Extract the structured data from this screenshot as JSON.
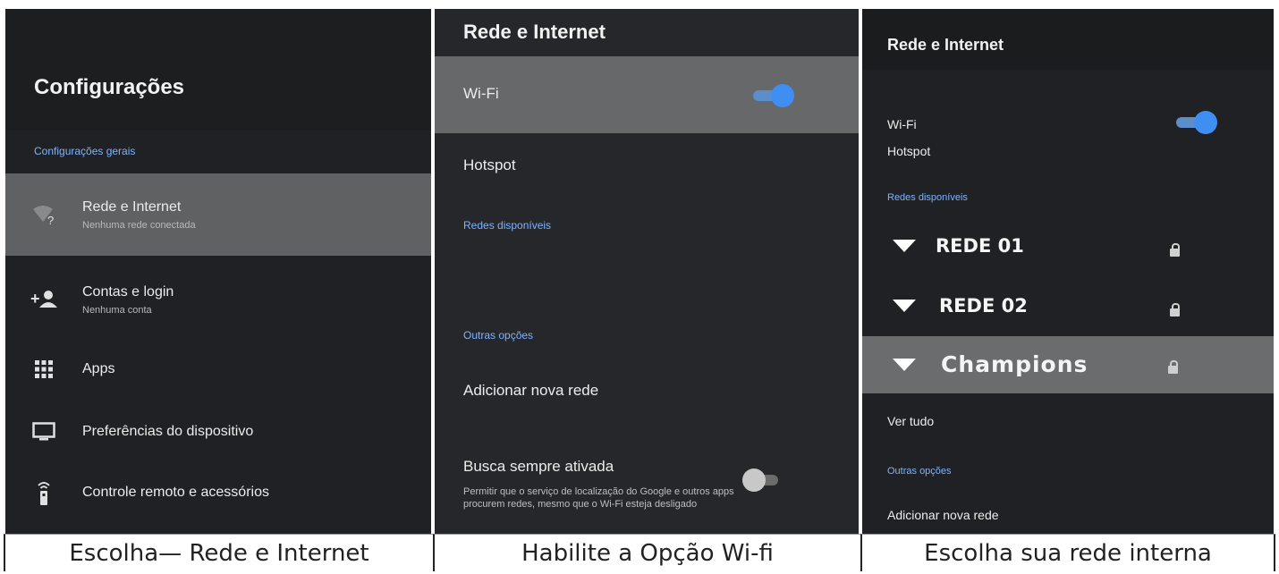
{
  "panel1": {
    "title": "Configurações",
    "section": "Configurações gerais",
    "items": [
      {
        "label": "Rede e Internet",
        "sub": "Nenhuma rede conectada",
        "icon": "wifi-question-icon",
        "selected": true
      },
      {
        "label": "Contas e login",
        "sub": "Nenhuma conta",
        "icon": "add-account-icon"
      },
      {
        "label": "Apps",
        "sub": "",
        "icon": "apps-grid-icon"
      },
      {
        "label": "Preferências do dispositivo",
        "sub": "",
        "icon": "monitor-icon"
      },
      {
        "label": "Controle remoto e acessórios",
        "sub": "",
        "icon": "remote-icon"
      }
    ],
    "caption": "Escolha— Rede e Internet"
  },
  "panel2": {
    "title": "Rede e Internet",
    "wifi_label": "Wi-Fi",
    "wifi_on": true,
    "hotspot": "Hotspot",
    "available_section": "Redes disponíveis",
    "other_section": "Outras opções",
    "add_network": "Adicionar nova rede",
    "always_scan": "Busca sempre ativada",
    "always_scan_sub": "Permitir que o serviço de localização do Google e outros apps procurem redes, mesmo que o Wi-Fi esteja desligado",
    "always_scan_on": false,
    "caption": "Habilite a Opção Wi-fi"
  },
  "panel3": {
    "title": "Rede e Internet",
    "wifi_label": "Wi-Fi",
    "wifi_on": true,
    "hotspot": "Hotspot",
    "available_section": "Redes disponíveis",
    "networks": [
      {
        "name": "REDE 01",
        "locked": true
      },
      {
        "name": "REDE 02",
        "locked": true
      },
      {
        "name": "Champions",
        "locked": true,
        "selected": true
      }
    ],
    "see_all": "Ver tudo",
    "other_section": "Outras opções",
    "add_network": "Adicionar nova rede",
    "caption": "Escolha sua rede interna"
  },
  "colors": {
    "accent": "#3f8ff2",
    "section": "#7fb3ff",
    "background": "#1f2124",
    "selected": "#5f6163"
  }
}
